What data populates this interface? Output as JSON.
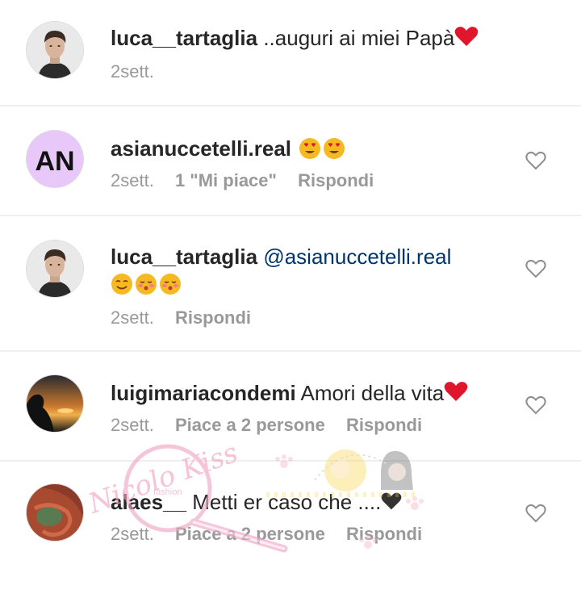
{
  "comments": [
    {
      "username": "luca__tartaglia",
      "text": "..auguri ai miei Papà",
      "time": "2sett.",
      "likes": "",
      "reply": "",
      "avatar": "man-portrait"
    },
    {
      "username": "asianuccetelli.real",
      "text": "",
      "time": "2sett.",
      "likes": "1 \"Mi piace\"",
      "reply": "Rispondi",
      "avatar_initials": "AN"
    },
    {
      "username": "luca__tartaglia",
      "mention": "@asianuccetelli.real",
      "text": "",
      "time": "2sett.",
      "likes": "",
      "reply": "Rispondi",
      "avatar": "man-portrait"
    },
    {
      "username": "luigimariacondemi",
      "text": "Amori della vita",
      "time": "2sett.",
      "likes": "Piace a 2 persone",
      "reply": "Rispondi",
      "avatar": "sunset-silhouette"
    },
    {
      "username": "alaes__",
      "text": "Metti er caso che ....",
      "time": "2sett.",
      "likes": "Piace a 2 persone",
      "reply": "Rispondi",
      "avatar": "red-hair-woman"
    }
  ],
  "watermark": {
    "text": "Nicolo Kiss",
    "small": "fashion"
  },
  "colors": {
    "text": "#262626",
    "meta": "#999999",
    "mention": "#003569",
    "heart": "#e0172c",
    "divider": "#efefef",
    "avatar_an_bg": "#e8c8f8"
  }
}
